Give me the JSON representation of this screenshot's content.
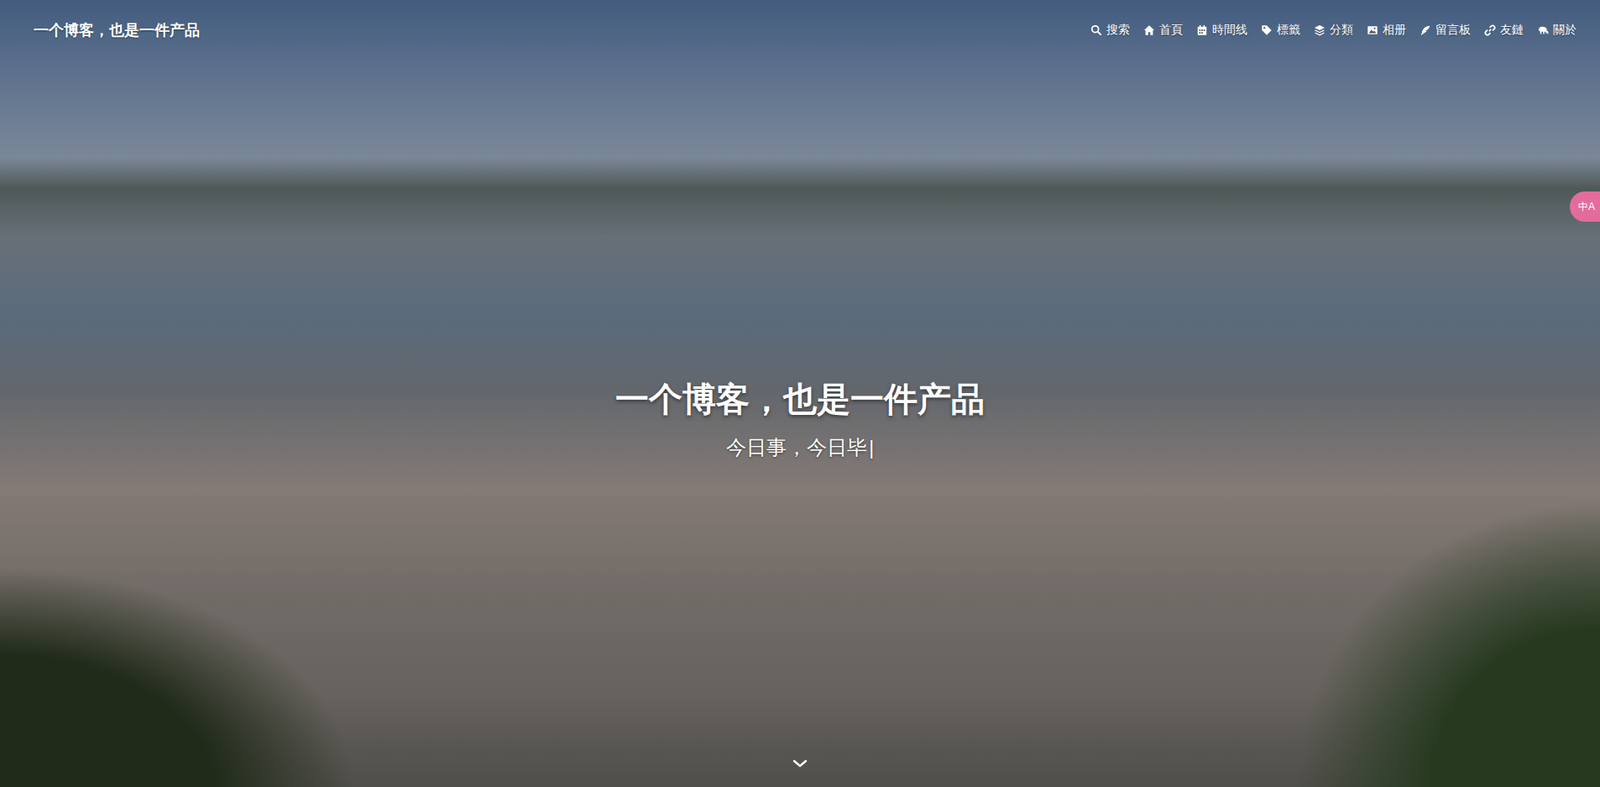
{
  "site": {
    "title": "一个博客，也是一件产品"
  },
  "nav": [
    {
      "label": "搜索"
    },
    {
      "label": "首頁"
    },
    {
      "label": "時間线"
    },
    {
      "label": "標籤"
    },
    {
      "label": "分類"
    },
    {
      "label": "相册"
    },
    {
      "label": "留言板"
    },
    {
      "label": "友鏈"
    },
    {
      "label": "關於"
    }
  ],
  "hero": {
    "title": "一个博客，也是一件产品",
    "subtitle": "今日事，今日毕",
    "cursor": "|"
  },
  "translate": {
    "label": "中A"
  }
}
